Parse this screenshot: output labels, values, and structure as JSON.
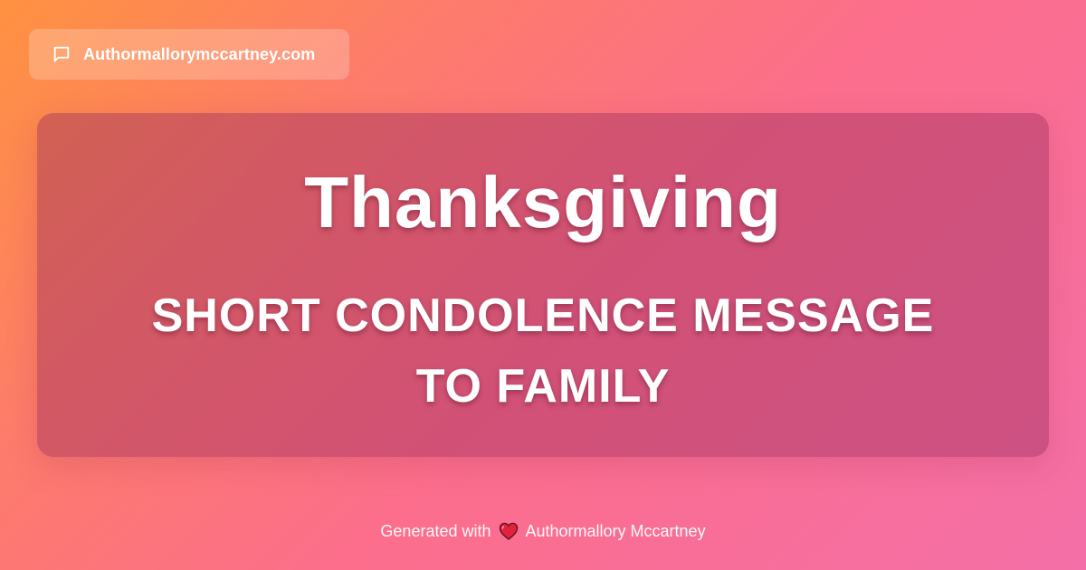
{
  "site": {
    "name": "Authormallorymccartney.com",
    "icon": "message-bubble-icon"
  },
  "card": {
    "title": "Thanksgiving",
    "subtitle_line1": "SHORT CONDOLENCE MESSAGE",
    "subtitle_line2": "TO FAMILY"
  },
  "footer": {
    "prefix": "Generated with",
    "heart_icon": "heart-icon",
    "author": "Authormallory Mccartney"
  },
  "colors": {
    "gradient_start": "#ff9240",
    "gradient_end": "#f46fa7",
    "heart": "#e0233c"
  }
}
